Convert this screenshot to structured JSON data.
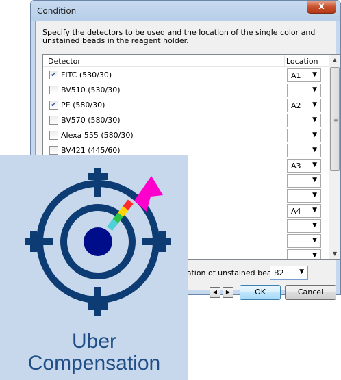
{
  "dialog": {
    "title": "Condition",
    "close_glyph": "x",
    "instructions": "Specify the detectors to be used and the location of the single color and unstained beads in the reagent holder.",
    "columns": {
      "detector": "Detector",
      "location": "Location"
    },
    "rows": [
      {
        "detector": "FITC (530/30)",
        "checked": true,
        "location": "A1"
      },
      {
        "detector": "BV510 (530/30)",
        "checked": false,
        "location": ""
      },
      {
        "detector": "PE (580/30)",
        "checked": true,
        "location": "A2"
      },
      {
        "detector": "BV570 (580/30)",
        "checked": false,
        "location": ""
      },
      {
        "detector": "Alexa 555 (580/30)",
        "checked": false,
        "location": ""
      },
      {
        "detector": "BV421 (445/60)",
        "checked": false,
        "location": ""
      },
      {
        "detector": "",
        "checked": false,
        "location": "A3"
      },
      {
        "detector": "",
        "checked": false,
        "location": ""
      },
      {
        "detector": "",
        "checked": false,
        "location": ""
      },
      {
        "detector": "",
        "checked": false,
        "location": "A4"
      },
      {
        "detector": "",
        "checked": false,
        "location": ""
      },
      {
        "detector": "",
        "checked": false,
        "location": ""
      },
      {
        "detector": "",
        "checked": false,
        "location": ""
      }
    ],
    "unstained_label": "Location of unstained beads:",
    "unstained_value": "B2",
    "ok_label": "OK",
    "cancel_label": "Cancel"
  },
  "logo": {
    "line1": "Uber",
    "line2": "Compensation",
    "colors": {
      "navy": "#0d3b73",
      "dot": "#000d8a",
      "background": "#c8d8ec",
      "text": "#1f4f86",
      "arrow_head": "#ff00cc"
    }
  }
}
